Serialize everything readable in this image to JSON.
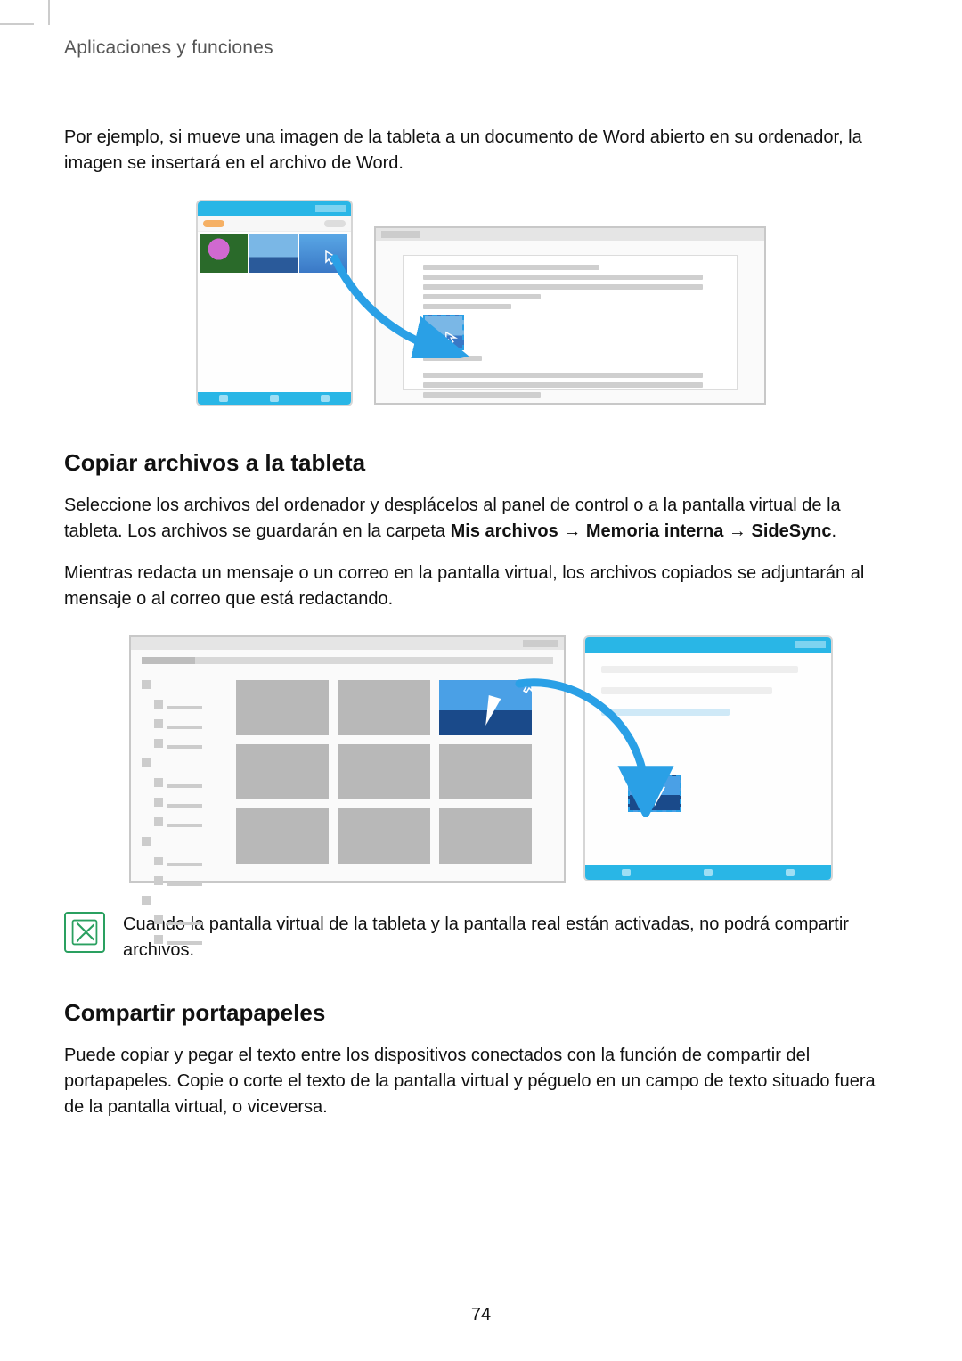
{
  "header": {
    "section_label": "Aplicaciones y funciones"
  },
  "intro_paragraph": "Por ejemplo, si mueve una imagen de la tableta a un documento de Word abierto en su ordenador, la imagen se insertará en el archivo de Word.",
  "section_copy": {
    "heading": "Copiar archivos a la tableta",
    "p1_pre": "Seleccione los archivos del ordenador y desplácelos al panel de control o a la pantalla virtual de la tableta. Los archivos se guardarán en la carpeta ",
    "p1_bold": "Mis archivos → Memoria interna → SideSync",
    "p1_post": ".",
    "p2": "Mientras redacta un mensaje o un correo en la pantalla virtual, los archivos copiados se adjuntarán al mensaje o al correo que está redactando."
  },
  "note_text": "Cuando la pantalla virtual de la tableta y la pantalla real están activadas, no podrá compartir archivos.",
  "section_clip": {
    "heading": "Compartir portapapeles",
    "p1": "Puede copiar y pegar el texto entre los dispositivos conectados con la función de compartir del portapapeles. Copie o corte el texto de la pantalla virtual y péguelo en un campo de texto situado fuera de la pantalla virtual, o viceversa."
  },
  "page_number": "74"
}
